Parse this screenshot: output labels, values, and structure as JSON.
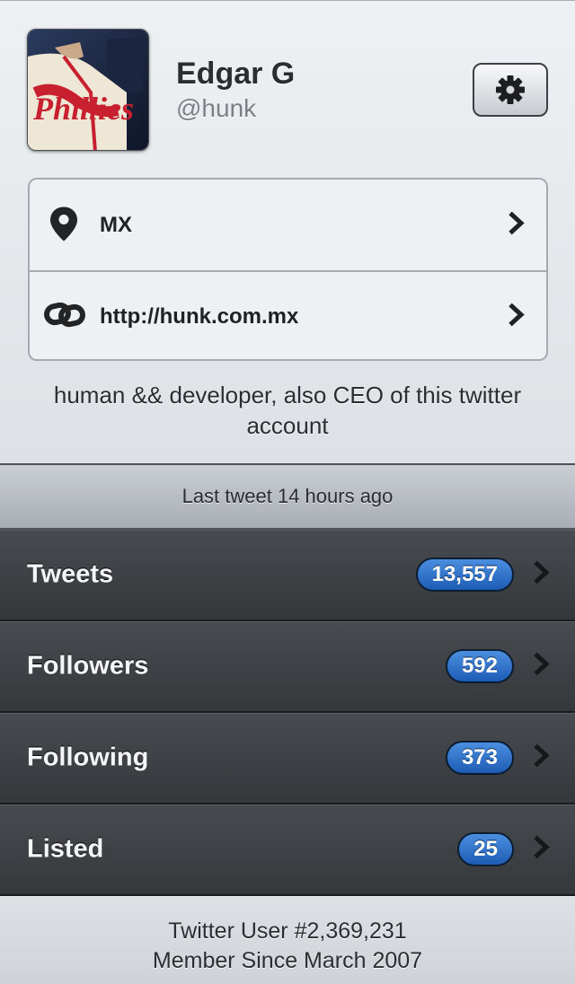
{
  "profile": {
    "name": "Edgar G",
    "handle": "@hunk",
    "avatar_text": "Phillies",
    "bio": "human && developer, also CEO of this twitter account"
  },
  "info": {
    "location": "MX",
    "url": "http://hunk.com.mx"
  },
  "last_tweet": "Last tweet 14 hours ago",
  "stats": [
    {
      "label": "Tweets",
      "count": "13,557"
    },
    {
      "label": "Followers",
      "count": "592"
    },
    {
      "label": "Following",
      "count": "373"
    },
    {
      "label": "Listed",
      "count": "25"
    }
  ],
  "footer": {
    "user_number": "Twitter User #2,369,231",
    "member_since": "Member Since March 2007"
  },
  "colors": {
    "badge_blue": "#2a6fcf",
    "stat_row_dark": "#3e4145",
    "header_light": "#e6e9ec"
  },
  "icons": {
    "settings": "gear-icon",
    "location": "map-pin-icon",
    "url": "link-icon",
    "disclosure": "chevron-right-icon"
  }
}
